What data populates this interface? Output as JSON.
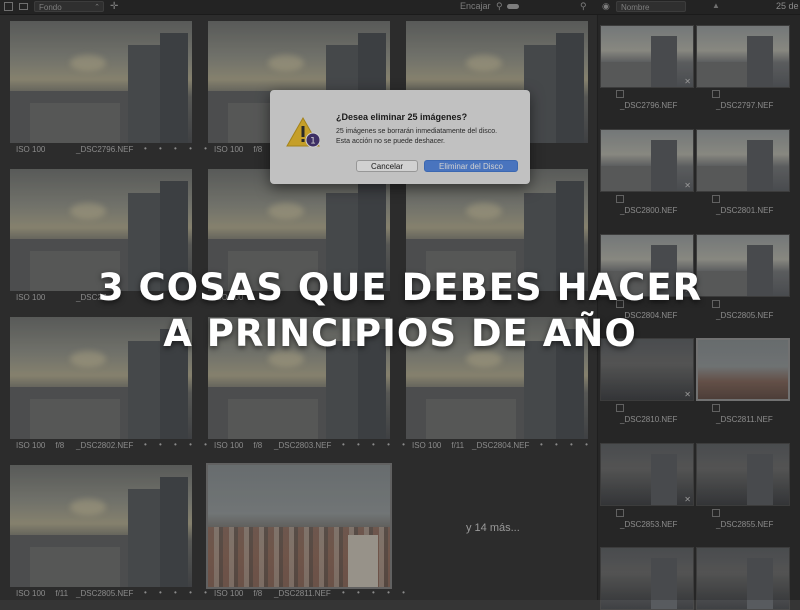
{
  "toolbar": {
    "folder_select": "Fondo",
    "fit_label": "Encajar",
    "sort_select": "Nombre",
    "count_text": "25 de"
  },
  "grid": {
    "cells": [
      {
        "iso": "ISO 100",
        "aperture": "",
        "file": "_DSC2796.NEF",
        "dots": "• • • • •"
      },
      {
        "iso": "ISO 100",
        "aperture": "f/8",
        "file": "_DSC2797.NEF",
        "dots": "• • • • •"
      },
      {
        "iso": "",
        "aperture": "",
        "file": "",
        "dots": ""
      },
      {
        "iso": "ISO 100",
        "aperture": "",
        "file": "_DSC27",
        "dots": ""
      },
      {
        "iso": "ISO 100",
        "aperture": "",
        "file": "",
        "dots": ""
      },
      {
        "iso": "",
        "aperture": "",
        "file": "",
        "dots": ""
      },
      {
        "iso": "ISO 100",
        "aperture": "f/8",
        "file": "_DSC2802.NEF",
        "dots": "• • • • •"
      },
      {
        "iso": "ISO 100",
        "aperture": "f/8",
        "file": "_DSC2803.NEF",
        "dots": "• • • • •"
      },
      {
        "iso": "ISO 100",
        "aperture": "f/11",
        "file": "_DSC2804.NEF",
        "dots": "• • • • •"
      },
      {
        "iso": "ISO 100",
        "aperture": "f/11",
        "file": "_DSC2805.NEF",
        "dots": "• • • • •"
      },
      {
        "iso": "ISO 100",
        "aperture": "f/8",
        "file": "_DSC2811.NEF",
        "dots": "• • • • •"
      }
    ],
    "more_text": "y 14 más..."
  },
  "strip": {
    "items": [
      {
        "label": "_DSC2796.NEF"
      },
      {
        "label": "_DSC2797.NEF"
      },
      {
        "label": "_DSC2800.NEF"
      },
      {
        "label": "_DSC2801.NEF"
      },
      {
        "label": "_DSC2804.NEF"
      },
      {
        "label": "_DSC2805.NEF"
      },
      {
        "label": "_DSC2810.NEF"
      },
      {
        "label": "_DSC2811.NEF"
      },
      {
        "label": "_DSC2853.NEF"
      },
      {
        "label": "_DSC2855.NEF"
      }
    ]
  },
  "dialog": {
    "title": "¿Desea eliminar 25 imágenes?",
    "message_line1": "25 imágenes se borrarán inmediatamente del disco.",
    "message_line2": "Esta acción no se puede deshacer.",
    "cancel_label": "Cancelar",
    "delete_label": "Eliminar del Disco",
    "accent_color": "#5a8ee8"
  },
  "headline": {
    "line1": "3 COSAS QUE DEBES HACER",
    "line2": "A PRINCIPIOS DE AÑO"
  }
}
